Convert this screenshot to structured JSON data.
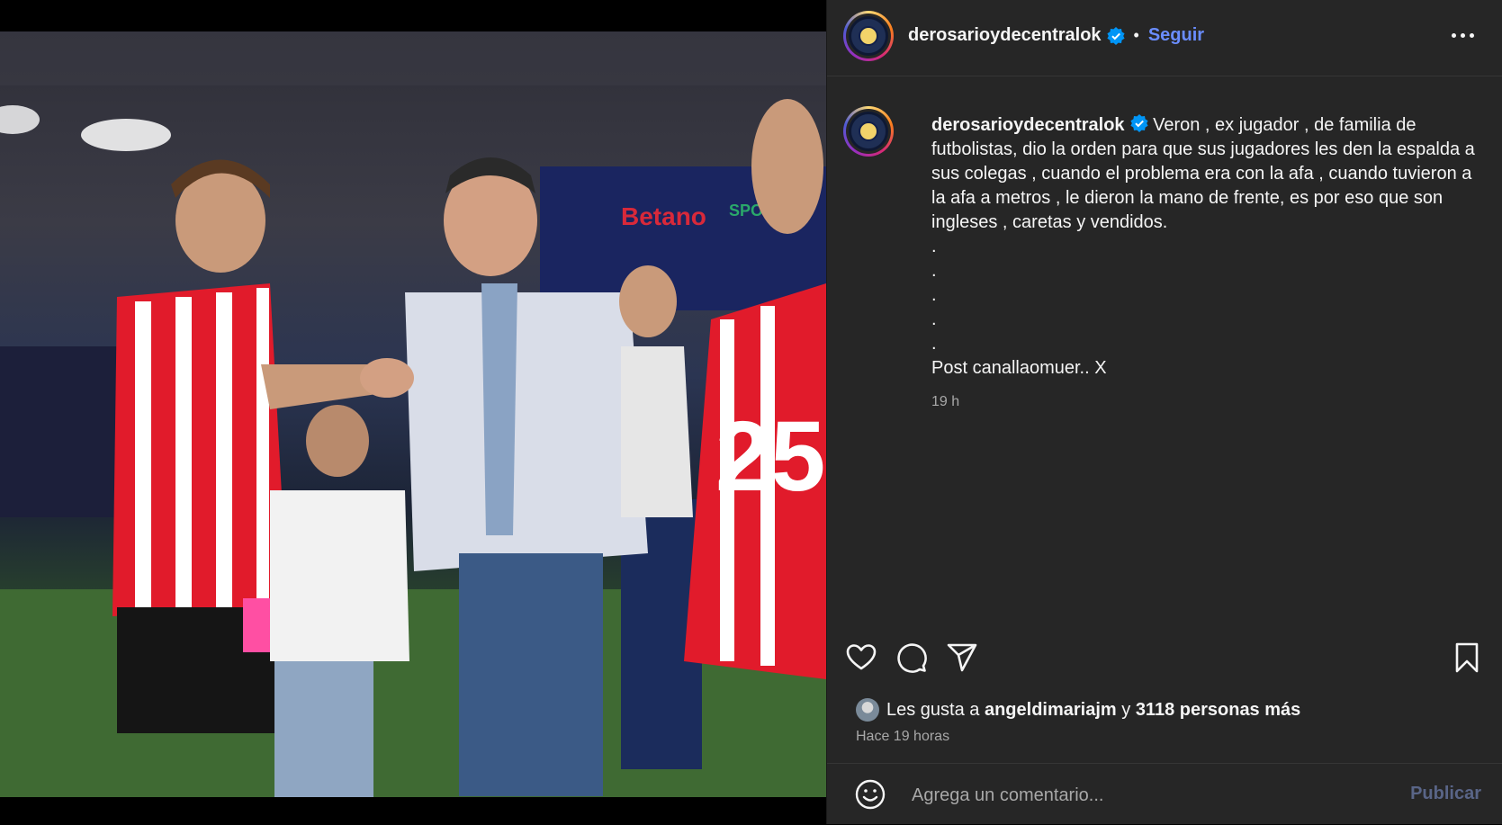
{
  "media": {
    "description_icon": "photo"
  },
  "post": {
    "account": "derosarioydecentralok",
    "follow_label": "Seguir",
    "separator": "•",
    "more_icon": "more-horizontal-icon",
    "caption": {
      "body": "Veron , ex jugador , de familia de futbolistas, dio la orden para que sus jugadores les den la espalda a sus colegas , cuando el problema era con la afa , cuando tuvieron a la afa a metros , le dieron la mano de frente, es por eso que son ingleses , caretas y vendidos.",
      "dots": [
        ".",
        ".",
        ".",
        ".",
        "."
      ],
      "signature": "Post canallaomuer.. X",
      "time": "19 h"
    },
    "likes": {
      "prefix": "Les gusta a ",
      "user": "angeldimariajm",
      "middle": " y ",
      "others": "3118 personas más"
    },
    "posted_ago": "Hace 19 horas",
    "comment": {
      "placeholder": "Agrega un comentario...",
      "publish_label": "Publicar"
    }
  },
  "colors": {
    "panel_bg": "#262626",
    "accent_link": "#6a8dff",
    "verified": "#0095f6",
    "muted_text": "#a8a8a8"
  }
}
